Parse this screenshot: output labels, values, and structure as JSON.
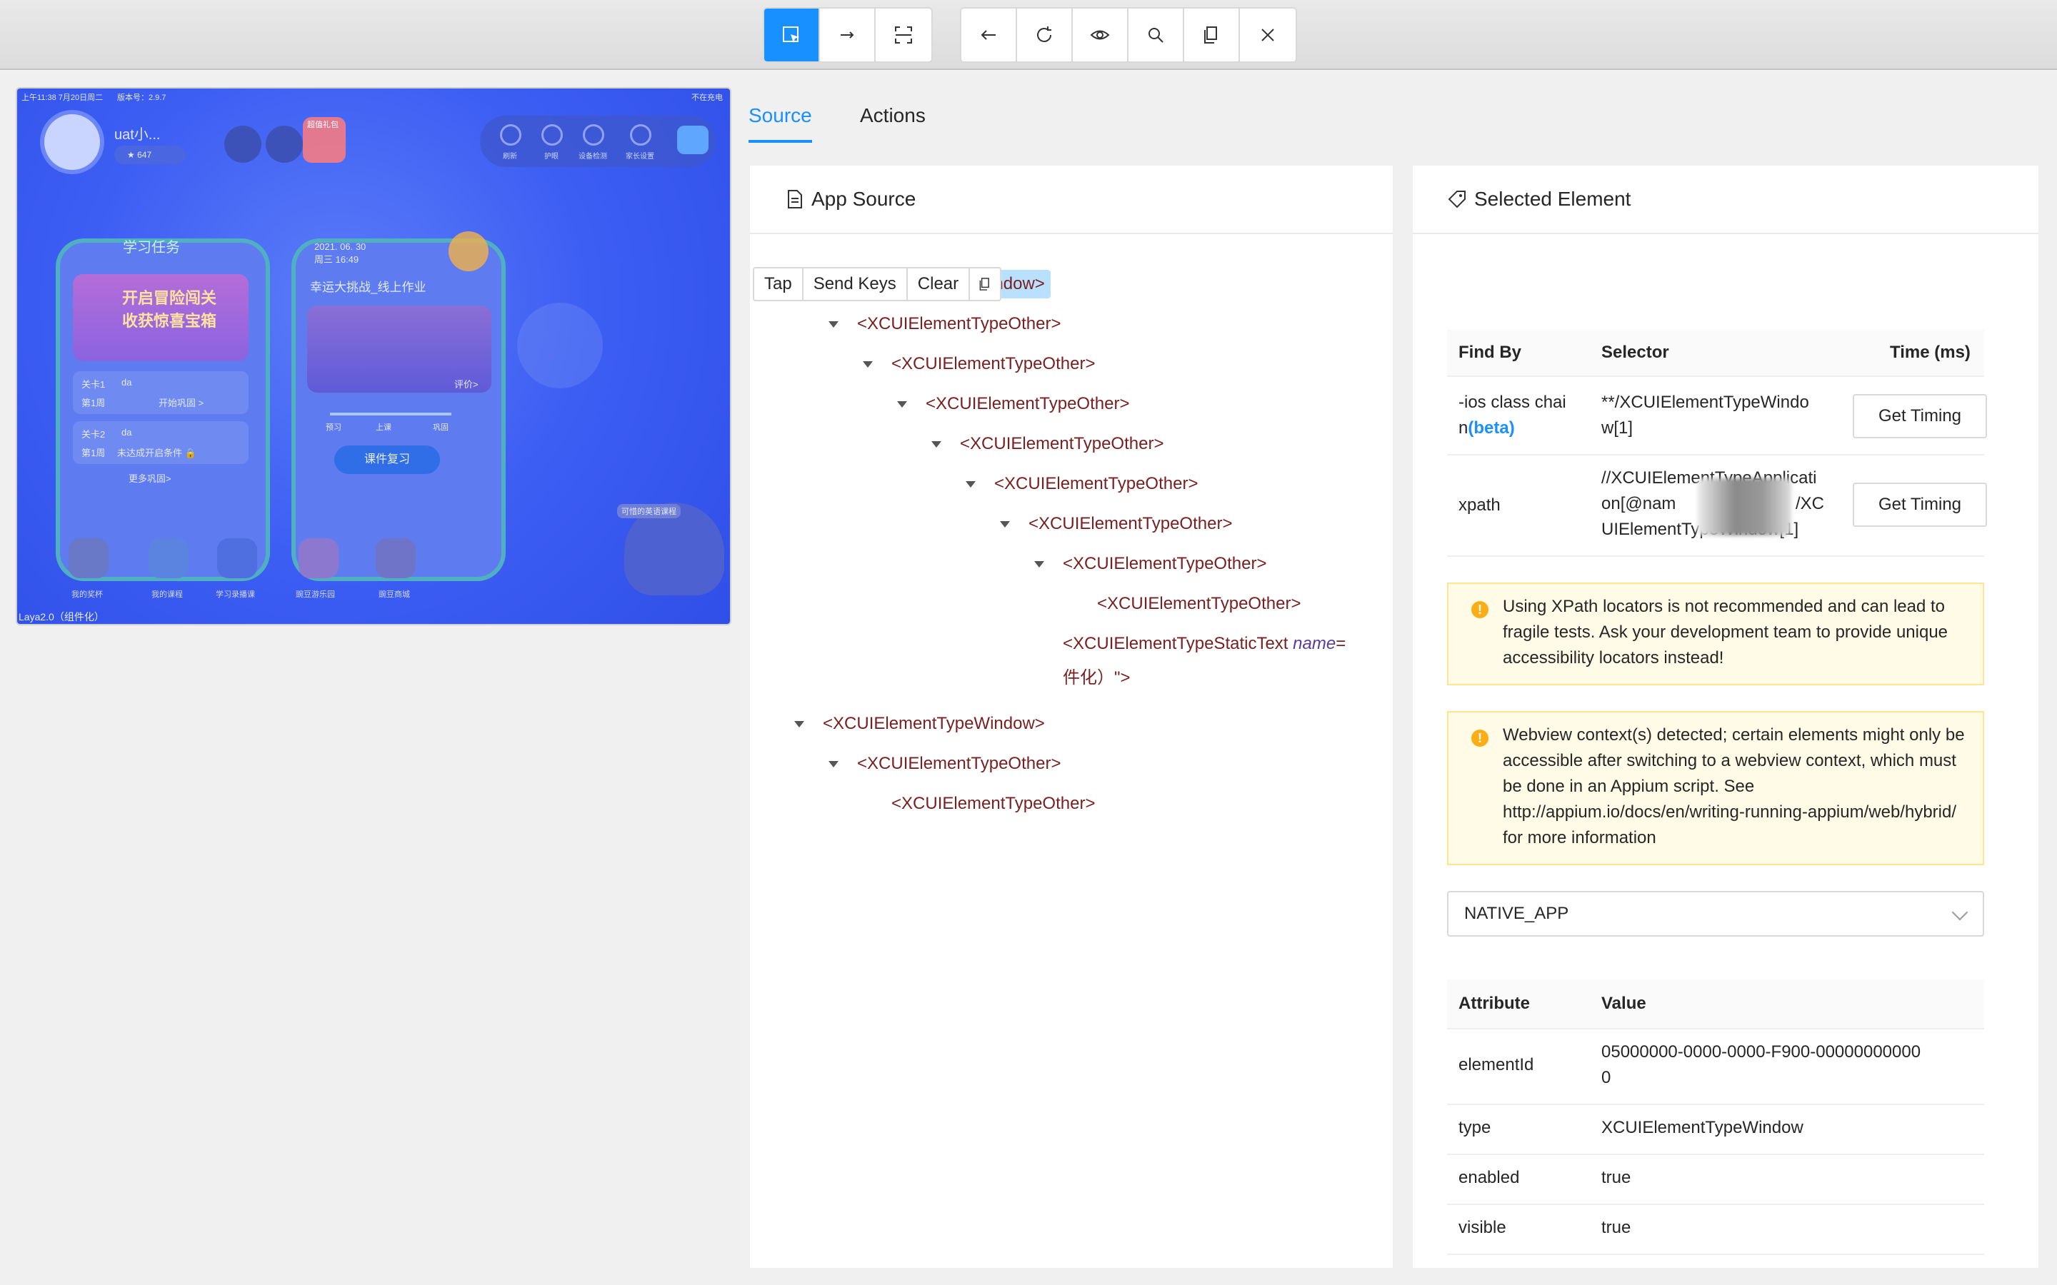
{
  "toolbar": {
    "left_group": [
      "select-element",
      "swipe",
      "tap-coordinates"
    ],
    "right_group": [
      "back",
      "refresh",
      "show-hidden",
      "search",
      "copy-xml",
      "quit-session"
    ],
    "accent": "#1890ff"
  },
  "preview": {
    "status_left": "上午11:38  7月20日周二",
    "status_center": "版本号：2.9.7",
    "status_right": "不在充电",
    "user_name": "uat小...",
    "stars": "647",
    "gift_label": "超值礼包",
    "top_items": [
      "刷新",
      "护眼",
      "设备检测",
      "家长设置"
    ],
    "card1_title": "学习任务",
    "card1_banner": "开启冒险闯关\n收获惊喜宝箱",
    "card1_rows": [
      {
        "level": "关卡1",
        "tag": "da",
        "week": "第1周",
        "action": "开始巩固 >"
      },
      {
        "level": "关卡2",
        "tag": "da",
        "week": "第1周",
        "action": "未达成开启条件 🔒"
      }
    ],
    "card1_more": "更多巩固>",
    "card2_date": "2021. 06. 30\n周三 16:49",
    "card2_title": "幸运大挑战_线上作业",
    "card2_review": "评价>",
    "card2_steps": [
      "预习",
      "上课",
      "巩固"
    ],
    "card2_button": "课件复习",
    "bottom_icons": [
      "我的奖杯",
      "我的课程",
      "学习录播课",
      "豌豆游乐园",
      "豌豆商城"
    ],
    "english_label": "可惜的英语课程",
    "footer": "Laya2.0（组件化）"
  },
  "tabs": {
    "source": "Source",
    "actions": "Actions"
  },
  "app_source": {
    "title": "App Source",
    "nodes": [
      {
        "text": "<XCUIElementTypeWindow>",
        "depth": 0,
        "caret": true,
        "selected": true
      },
      {
        "text": "<XCUIElementTypeOther>",
        "depth": 1,
        "caret": true
      },
      {
        "text": "<XCUIElementTypeOther>",
        "depth": 2,
        "caret": true
      },
      {
        "text": "<XCUIElementTypeOther>",
        "depth": 3,
        "caret": true
      },
      {
        "text": "<XCUIElementTypeOther>",
        "depth": 4,
        "caret": true
      },
      {
        "text": "<XCUIElementTypeOther>",
        "depth": 5,
        "caret": true
      },
      {
        "text": "<XCUIElementTypeOther>",
        "depth": 6,
        "caret": true
      },
      {
        "text": "<XCUIElementTypeOther>",
        "depth": 7,
        "caret": true
      },
      {
        "text": "<XCUIElementTypeOther>",
        "depth": 8,
        "caret": false
      },
      {
        "text": "<XCUIElementTypeStaticText ",
        "attr": "name",
        "attr_suffix": "=",
        "depth": 7,
        "caret": false,
        "continuation": "件化）\">"
      },
      {
        "text": "<XCUIElementTypeWindow>",
        "depth": 0,
        "caret": true
      },
      {
        "text": "<XCUIElementTypeOther>",
        "depth": 1,
        "caret": true
      },
      {
        "text": "<XCUIElementTypeOther>",
        "depth": 2,
        "caret": false
      }
    ]
  },
  "selected": {
    "title": "Selected Element",
    "buttons": {
      "tap": "Tap",
      "send_keys": "Send Keys",
      "clear": "Clear"
    },
    "headers": {
      "find_by": "Find By",
      "selector": "Selector",
      "time": "Time (ms)"
    },
    "rows": [
      {
        "find_by_a": "-ios class chai",
        "find_by_b": "n",
        "beta": "(beta)",
        "selector_a": "**/XCUIElementTypeWindo",
        "selector_b": "w[1]",
        "button": "Get Timing"
      },
      {
        "find_by": "xpath",
        "selector_a": "//XCUIElementTypeApplicati",
        "selector_b": "on[@nam",
        "selector_b2": "/XC",
        "selector_c": "UIElementTypeWindow[1]",
        "button": "Get Timing"
      }
    ],
    "warning1": "Using XPath locators is not recommended and can lead to fragile tests. Ask your development team to provide unique accessibility locators instead!",
    "warning2": "Webview context(s) detected; certain elements might only be accessible after switching to a webview context, which must be done in an Appium script. See http://appium.io/docs/en/writing-running-appium/web/hybrid/ for more information",
    "context": "NATIVE_APP",
    "attr_headers": {
      "attribute": "Attribute",
      "value": "Value"
    },
    "attributes": [
      {
        "name": "elementId",
        "value_a": "05000000-0000-0000-F900-00000000000",
        "value_b": "0"
      },
      {
        "name": "type",
        "value": "XCUIElementTypeWindow"
      },
      {
        "name": "enabled",
        "value": "true"
      },
      {
        "name": "visible",
        "value": "true"
      }
    ]
  }
}
